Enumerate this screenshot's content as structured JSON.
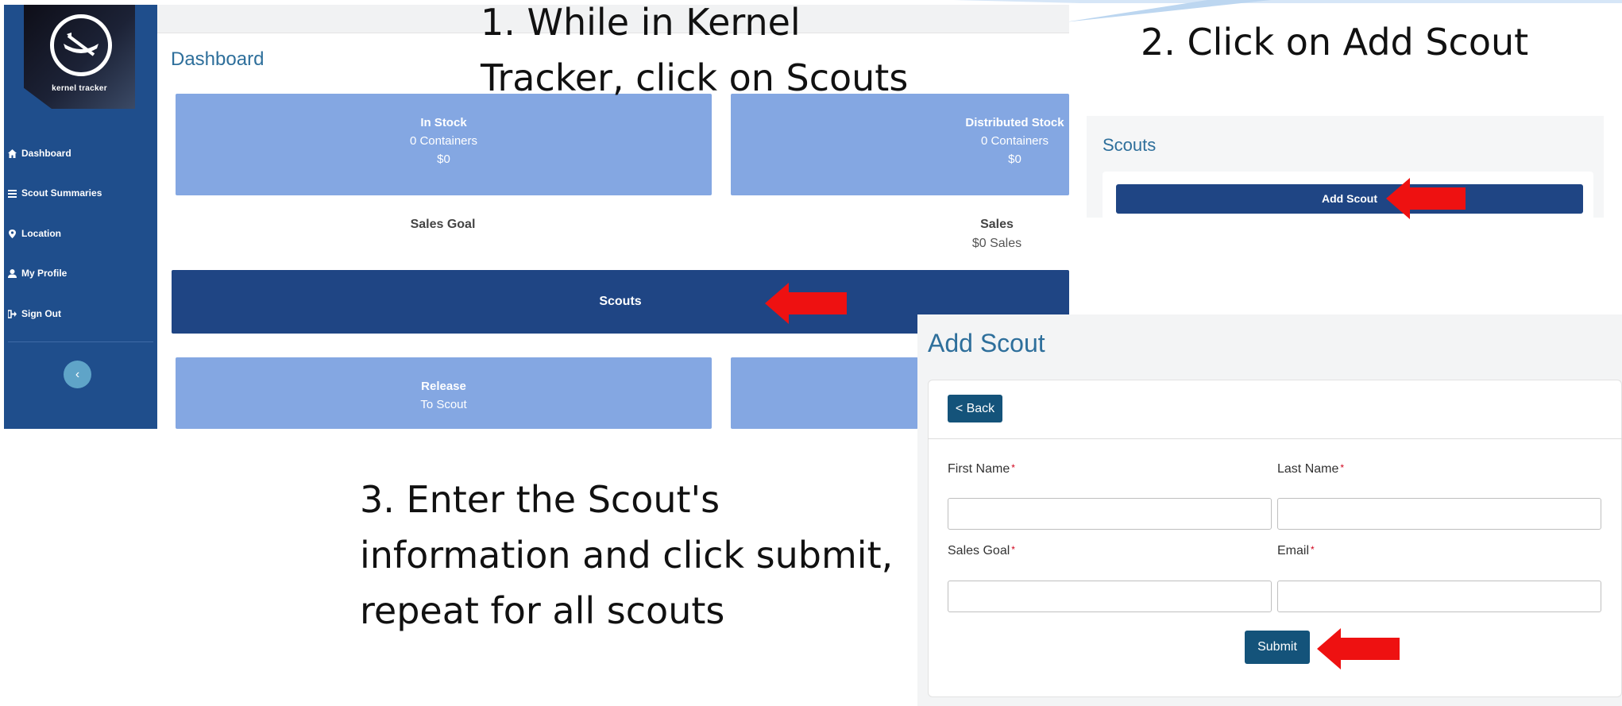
{
  "captions": {
    "step1": "1. While in Kernel\nTracker, click on Scouts",
    "step2": "2. Click on Add Scout",
    "step3": "3. Enter the Scout's\ninformation and click submit,\nrepeat for all scouts"
  },
  "dashboard": {
    "logo_text": "kernel tracker",
    "sidebar": {
      "items": [
        {
          "icon": "home-icon",
          "label": "Dashboard"
        },
        {
          "icon": "list-icon",
          "label": "Scout Summaries"
        },
        {
          "icon": "map-pin-icon",
          "label": "Location"
        },
        {
          "icon": "user-icon",
          "label": "My Profile"
        },
        {
          "icon": "sign-out-icon",
          "label": "Sign Out"
        }
      ],
      "collapse_icon": "chevron-left-icon"
    },
    "title": "Dashboard",
    "cards": {
      "in_stock": {
        "title": "In Stock",
        "containers": "0 Containers",
        "amount": "$0"
      },
      "distributed": {
        "title": "Distributed Stock",
        "containers": "0 Containers",
        "amount": "$0"
      },
      "release": {
        "title": "Release",
        "subtitle": "To Scout"
      }
    },
    "stats": {
      "sales_goal": {
        "title": "Sales Goal"
      },
      "sales": {
        "title": "Sales",
        "value": "$0 Sales"
      }
    },
    "scouts_button": "Scouts"
  },
  "scouts_panel": {
    "title": "Scouts",
    "add_button": "Add Scout"
  },
  "add_scout": {
    "title": "Add Scout",
    "back_button": "< Back",
    "fields": {
      "first_name": {
        "label": "First Name",
        "value": ""
      },
      "last_name": {
        "label": "Last Name",
        "value": ""
      },
      "sales_goal": {
        "label": "Sales Goal",
        "value": ""
      },
      "email": {
        "label": "Email",
        "value": ""
      }
    },
    "required_mark": "*",
    "submit_button": "Submit"
  },
  "colors": {
    "sidebar": "#1f4e8c",
    "card": "#84a7e2",
    "primary_button": "#1f4584",
    "form_button": "#14537a",
    "arrow": "#ee1111",
    "heading": "#2e6f9b"
  }
}
